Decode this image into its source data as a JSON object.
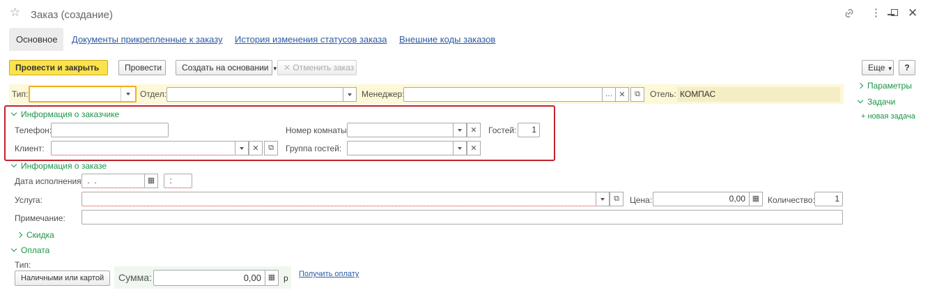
{
  "window": {
    "title": "Заказ (создание)",
    "icons": [
      "star-icon",
      "link-icon",
      "more-icon",
      "minimize-icon",
      "maximize-icon",
      "close-icon"
    ]
  },
  "tabs": [
    {
      "label": "Основное",
      "active": true
    },
    {
      "label": "Документы прикрепленные к заказу"
    },
    {
      "label": "История изменения статусов заказа"
    },
    {
      "label": "Внешние коды заказов"
    }
  ],
  "toolbar": {
    "post_close": "Провести и закрыть",
    "post": "Провести",
    "create_based": "Создать на основании",
    "cancel_order": "Отменить заказ",
    "more": "Еще",
    "help": "?"
  },
  "header_fields": {
    "type_label": "Тип:",
    "type_value": "",
    "department_label": "Отдел:",
    "department_value": "",
    "manager_label": "Менеджер:",
    "manager_value": "",
    "hotel_label": "Отель:",
    "hotel_value": "КОМПАС"
  },
  "customer_info": {
    "title": "Информация о заказчике",
    "phone_label": "Телефон:",
    "phone_value": "",
    "client_label": "Клиент:",
    "client_value": "",
    "room_label": "Номер комнаты:",
    "room_value": "",
    "guests_label": "Гостей:",
    "guests_value": "1",
    "guest_group_label": "Группа гостей:",
    "guest_group_value": ""
  },
  "order_info": {
    "title": "Информация о заказе",
    "date_label": "Дата исполнения:",
    "date_value": " .  .",
    "time_value": " :",
    "service_label": "Услуга:",
    "service_value": "",
    "price_label": "Цена:",
    "price_value": "0,00",
    "quantity_label": "Количество:",
    "quantity_value": "1",
    "note_label": "Примечание:",
    "note_value": ""
  },
  "discount": {
    "title": "Скидка"
  },
  "payment": {
    "title": "Оплата",
    "type_label": "Тип:",
    "type_button": "Наличными или картой",
    "sum_label": "Сумма:",
    "sum_value": "0,00",
    "currency": "р",
    "get_payment": "Получить оплату"
  },
  "side_panel": {
    "params": "Параметры",
    "tasks": "Задачи",
    "new_task": "+ новая задача"
  },
  "colors": {
    "accent_green": "#1a9446",
    "primary_button": "#fce34b",
    "highlight_frame": "#c0232b",
    "header_band": "#fdf8d6",
    "link": "#2d5aa3"
  }
}
